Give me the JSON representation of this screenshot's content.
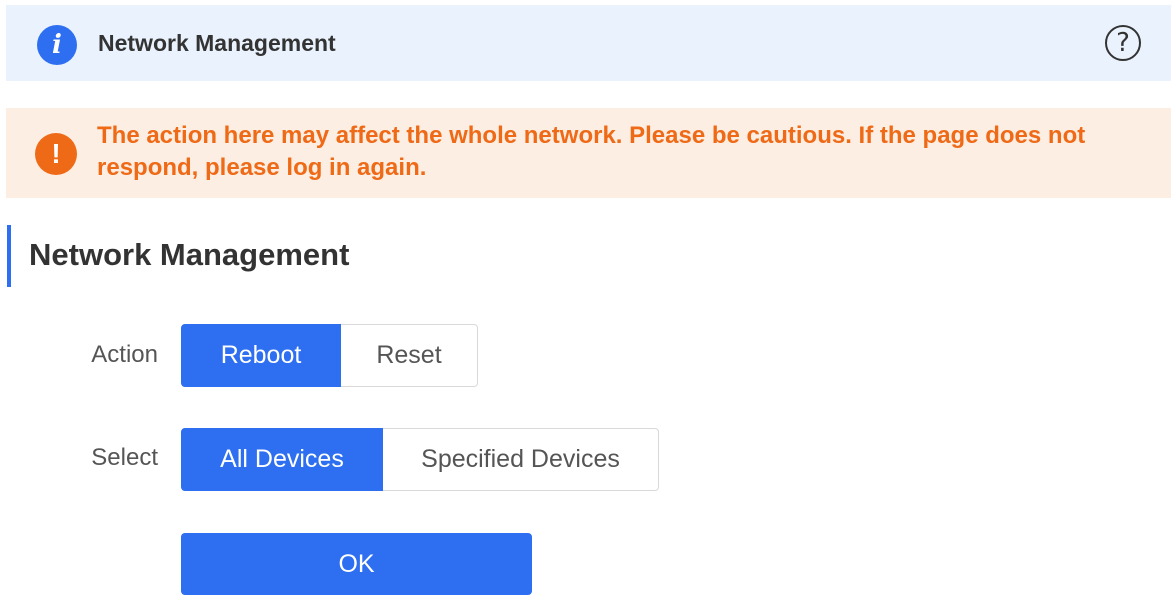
{
  "header": {
    "info_icon_glyph": "i",
    "title": "Network Management",
    "help_icon_glyph": "?"
  },
  "warning": {
    "icon_glyph": "!",
    "text": "The action here may affect the whole network. Please be cautious. If the page does not respond, please log in again."
  },
  "section": {
    "title": "Network Management"
  },
  "form": {
    "action": {
      "label": "Action",
      "options": [
        "Reboot",
        "Reset"
      ],
      "selected": "Reboot"
    },
    "select": {
      "label": "Select",
      "options": [
        "All Devices",
        "Specified Devices"
      ],
      "selected": "All Devices"
    },
    "ok_label": "OK"
  },
  "colors": {
    "accent": "#2d6ff0",
    "warning": "#ef6a17",
    "info_bg": "#eaf3fd",
    "warning_bg": "#fdeee3"
  }
}
